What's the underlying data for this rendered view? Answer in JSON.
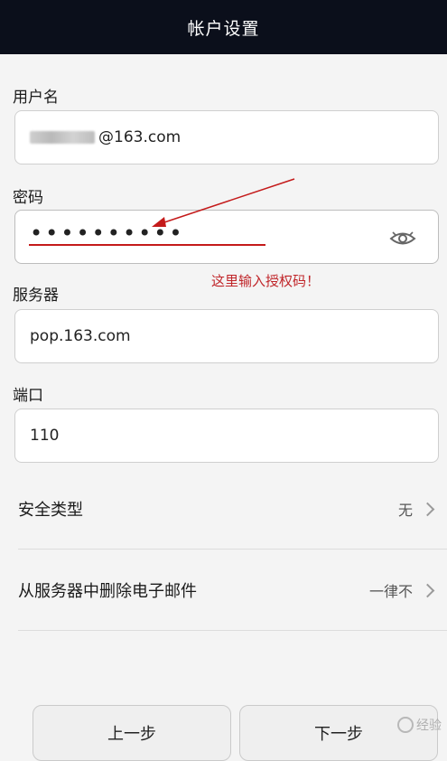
{
  "header": {
    "title": "帐户设置"
  },
  "username": {
    "label": "用户名",
    "value_suffix": "@163.com"
  },
  "password": {
    "label": "密码",
    "value": "••••••••••"
  },
  "annotation": {
    "text": "这里输入授权码！",
    "color": "#c0262a"
  },
  "server": {
    "label": "服务器",
    "value": "pop.163.com"
  },
  "port": {
    "label": "端口",
    "value": "110"
  },
  "security_type": {
    "label": "安全类型",
    "value": "无"
  },
  "delete_from_server": {
    "label": "从服务器中删除电子邮件",
    "value": "一律不"
  },
  "buttons": {
    "prev": "上一步",
    "next": "下一步"
  },
  "watermark": {
    "text": "经验"
  },
  "colors": {
    "titlebar": "#0b0f1b",
    "annotation_red": "#c41a1a"
  },
  "icons": [
    "eye-icon",
    "chevron-right-icon"
  ]
}
